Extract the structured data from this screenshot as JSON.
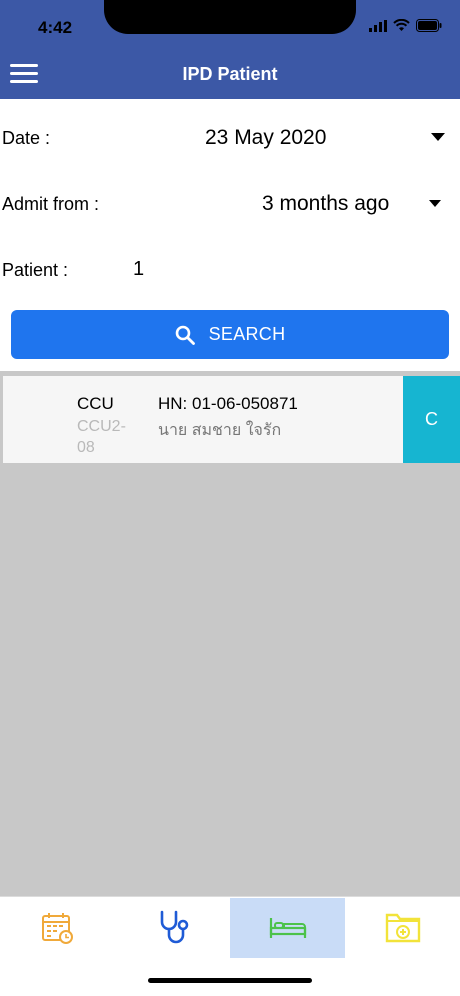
{
  "status_bar": {
    "time": "4:42"
  },
  "header": {
    "title": "IPD Patient"
  },
  "filters": {
    "date_label": "Date :",
    "date_value": "23 May 2020",
    "admit_label": "Admit from :",
    "admit_value": "3 months ago",
    "patient_label": "Patient :",
    "patient_count": "1"
  },
  "search": {
    "label": "SEARCH"
  },
  "patients": [
    {
      "ward": "CCU",
      "bed": "CCU2-08",
      "hn": "HN: 01-06-050871",
      "name": "นาย สมชาย ใจรัก",
      "status": "C"
    }
  ],
  "colors": {
    "header": "#3c58a6",
    "search_button": "#1f75ee",
    "status_tag": "#16b5d1",
    "list_background": "#c8c8c8",
    "active_tab": "#c9dcf7"
  },
  "tabs": [
    {
      "icon": "calendar-clock-icon",
      "color": "#f0a93a",
      "active": false
    },
    {
      "icon": "stethoscope-icon",
      "color": "#1f5bd6",
      "active": false
    },
    {
      "icon": "bed-icon",
      "color": "#4cc24a",
      "active": true
    },
    {
      "icon": "medical-folder-icon",
      "color": "#f2e33a",
      "active": false
    }
  ]
}
